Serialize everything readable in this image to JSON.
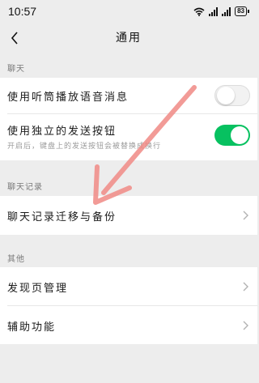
{
  "status_bar": {
    "time": "10:57",
    "battery": "83"
  },
  "nav": {
    "title": "通用"
  },
  "sections": {
    "chat": {
      "header": "聊天",
      "listen_speaker_label": "使用听筒播放语音消息",
      "listen_speaker_on": false,
      "send_button_label": "使用独立的发送按钮",
      "send_button_desc": "开启后，键盘上的发送按钮会被替换成换行",
      "send_button_on": true
    },
    "history": {
      "header": "聊天记录",
      "migrate_label": "聊天记录迁移与备份"
    },
    "other": {
      "header": "其他",
      "discover_label": "发现页管理",
      "accessibility_label": "辅助功能"
    }
  },
  "colors": {
    "accent_green": "#07c160",
    "annotation_arrow": "#f08a85"
  },
  "icons": {
    "back": "back-chevron-icon",
    "row_arrow": "chevron-right-icon",
    "wifi": "wifi-icon",
    "signal": "signal-icon",
    "battery": "battery-icon"
  }
}
